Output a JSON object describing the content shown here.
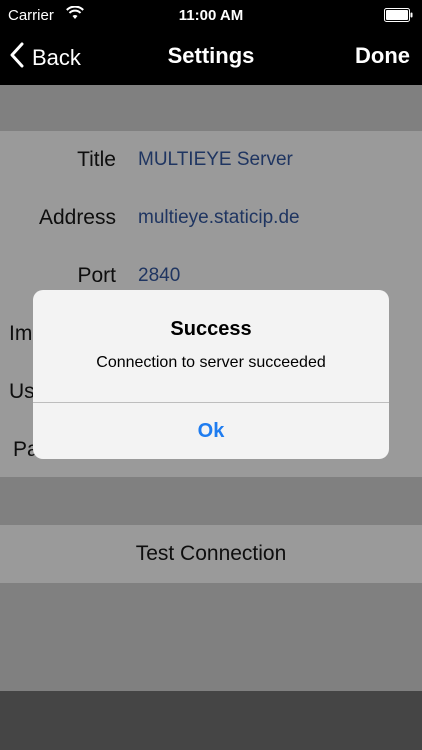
{
  "status_bar": {
    "carrier": "Carrier",
    "time": "11:00 AM",
    "wifi_icon": "wifi-icon",
    "battery_icon": "battery-icon"
  },
  "nav": {
    "back_label": "Back",
    "title": "Settings",
    "done_label": "Done"
  },
  "form": {
    "rows": [
      {
        "label": "Title",
        "value": "MULTIEYE Server"
      },
      {
        "label": "Address",
        "value": "multieye.staticip.de"
      },
      {
        "label": "Port",
        "value": "2840"
      },
      {
        "label": "Im",
        "value": ""
      },
      {
        "label": "Us",
        "value": ""
      },
      {
        "label": "Pa",
        "value": ""
      }
    ]
  },
  "test_button": {
    "label": "Test Connection"
  },
  "alert": {
    "title": "Success",
    "message": "Connection to server succeeded",
    "ok_label": "Ok"
  },
  "colors": {
    "accent": "#1e7cf0",
    "value_text": "#1f3561"
  }
}
